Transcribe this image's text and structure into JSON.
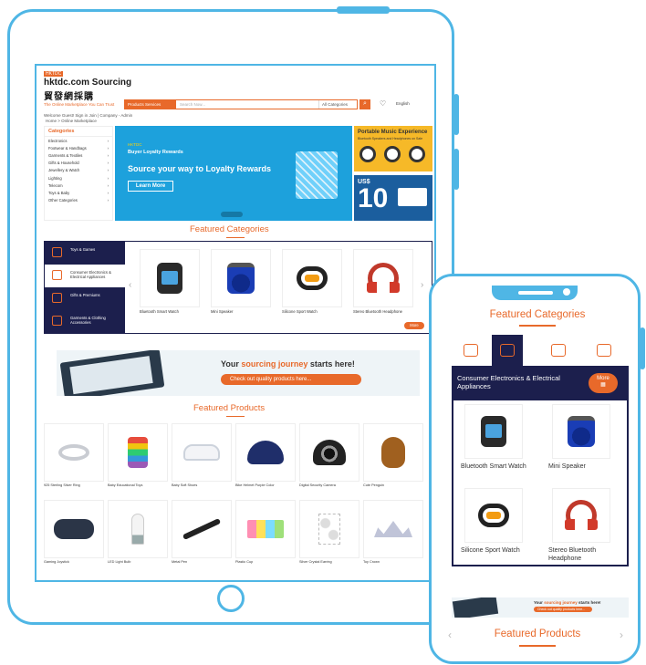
{
  "tablet": {
    "header": {
      "logo_badge": "HKTDC",
      "logo_title": "hktdc.com Sourcing",
      "logo_cn": "貿發網採購",
      "tagline": "The Online Marketplace You Can Trust",
      "search_category": "Products Services",
      "search_placeholder": "Search Now...",
      "search_all": "All Categories",
      "lang": "English",
      "welcome": "Welcome Guest! Sign in Join | Company - Admin",
      "breadcrumb": "Home > Online Marketplace"
    },
    "categories": {
      "title": "Categories",
      "items": [
        "Electronics",
        "Footwear & Handbags",
        "Garments & Textiles",
        "Gifts & Household",
        "Jewellery & Watch",
        "Lighting",
        "Telecom",
        "Toys & Baby",
        "Other Categories"
      ]
    },
    "hero": {
      "brand": "HKTDC",
      "subtitle": "Buyer Loyalty Rewards",
      "headline": "Source your way to Loyalty Rewards",
      "button": "Learn More"
    },
    "promo1": {
      "title": "Portable Music Experience",
      "subtitle": "Bluetooth Speakers and Headphones on Sale"
    },
    "promo2": {
      "currency": "US$",
      "amount": "10"
    },
    "featured_categories": {
      "title": "Featured Categories",
      "categories": [
        "Toys & Games",
        "Consumer Electronics & Electrical Appliances",
        "Gifts & Premiums",
        "Garments & Clothing Accessories"
      ],
      "products": [
        "Bluetooth Smart Watch",
        "Mini Speaker",
        "Silicone Sport Watch",
        "Stereo Bluetooth Headphone"
      ],
      "more": "More"
    },
    "journey": {
      "text_pre": "Your",
      "text_highlight": "sourcing journey",
      "text_post": "starts here!",
      "button": "Check out quality products here..."
    },
    "featured_products": {
      "title": "Featured Products",
      "row1": [
        "925 Sterling Silver Ring",
        "Baby Educational Toys",
        "Baby Soft Shoes",
        "Bike Helmet Purple Color",
        "Digital Security Camera",
        "Cute Penguin"
      ],
      "row2": [
        "Gaming Joystick",
        "LED Light Bulb",
        "Metal Pen",
        "Plastic Cup",
        "Silver Crystal Earring",
        "Toy Crown"
      ]
    }
  },
  "phone": {
    "featured_categories_title": "Featured Categories",
    "active_category": "Consumer Electronics & Electrical Appliances",
    "more": "More",
    "products": [
      "Bluetooth Smart Watch",
      "Mini Speaker",
      "Silicone Sport Watch",
      "Stereo Bluetooth Headphone"
    ],
    "banner_pre": "Your",
    "banner_highlight": "sourcing journey",
    "banner_post": "starts here!",
    "banner_button": "Check out quality products here...",
    "featured_products_title": "Featured Products"
  },
  "colors": {
    "accent": "#e8692a",
    "frame": "#4fb6e5",
    "navy": "#1c1f4d",
    "hero_blue": "#1da1dc"
  }
}
